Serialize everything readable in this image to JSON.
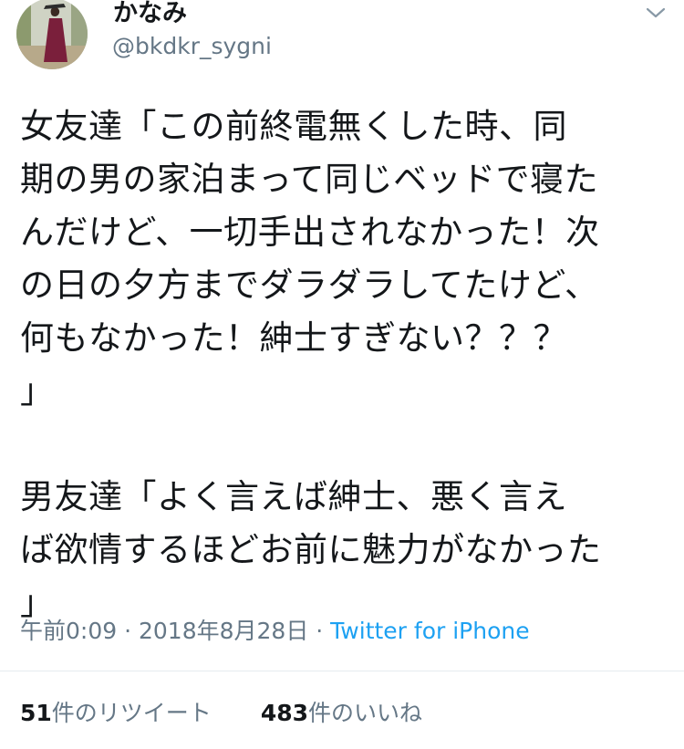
{
  "tweet": {
    "user": {
      "display_name": "かなみ",
      "handle": "@bkdkr_sygni",
      "avatar": "avatar-photo"
    },
    "menu_icon": "chevron-down-icon",
    "body": {
      "paragraph1": [
        "女友達「この前終電無くした時、同",
        "期の男の家泊まって同じベッドで寝た",
        "んだけど、一切手出されなかった！次",
        "の日の夕方までダラダラしてたけど、",
        "何もなかった！紳士すぎない？？？",
        "」"
      ],
      "paragraph2": [
        "男友達「よく言えば紳士、悪く言え",
        "ば欲情するほどお前に魅力がなかった",
        "」"
      ]
    },
    "meta": {
      "time": "午前0:09",
      "separator": " · ",
      "date": "2018年8月28日",
      "via": "Twitter for iPhone"
    },
    "stats": {
      "retweets_count": "51",
      "retweets_label": "件のリツイート",
      "likes_count": "483",
      "likes_label": "件のいいね"
    }
  },
  "colors": {
    "text": "#14171a",
    "secondary": "#657786",
    "link": "#1da1f2",
    "divider": "#e6ecf0"
  }
}
